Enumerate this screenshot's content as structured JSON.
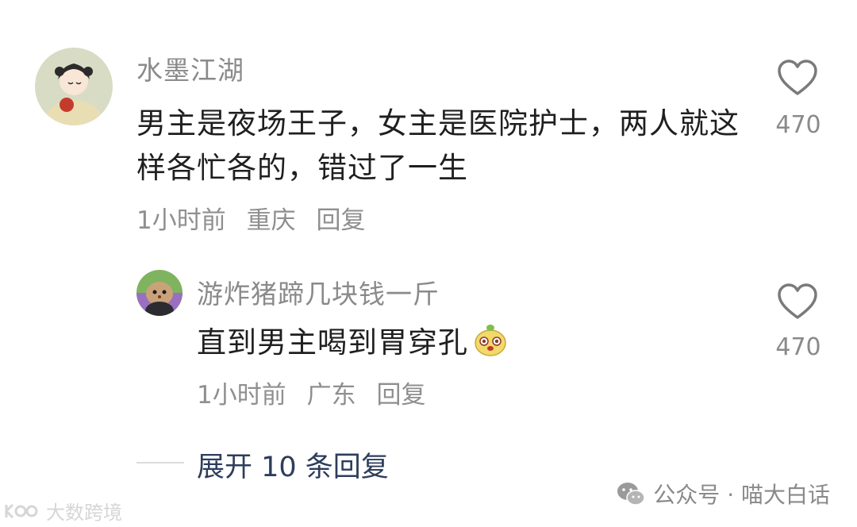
{
  "comment": {
    "username": "水墨江湖",
    "text": "男主是夜场王子，女主是医院护士，两人就这样各忙各的，错过了一生",
    "time": "1小时前",
    "location": "重庆",
    "reply_label": "回复",
    "likes": "470"
  },
  "reply": {
    "username": "游炸猪蹄几块钱一斤",
    "text": "直到男主喝到胃穿孔",
    "time": "1小时前",
    "location": "广东",
    "reply_label": "回复",
    "likes": "470"
  },
  "expand_label": "展开 10 条回复",
  "watermark_right": "公众号 · 喵大白话",
  "watermark_left": "大数跨境",
  "colors": {
    "username": "#8a8a8a",
    "body_text": "#1f1f1f",
    "meta": "#8f8f8f",
    "expand_link": "#2d3d5c"
  }
}
